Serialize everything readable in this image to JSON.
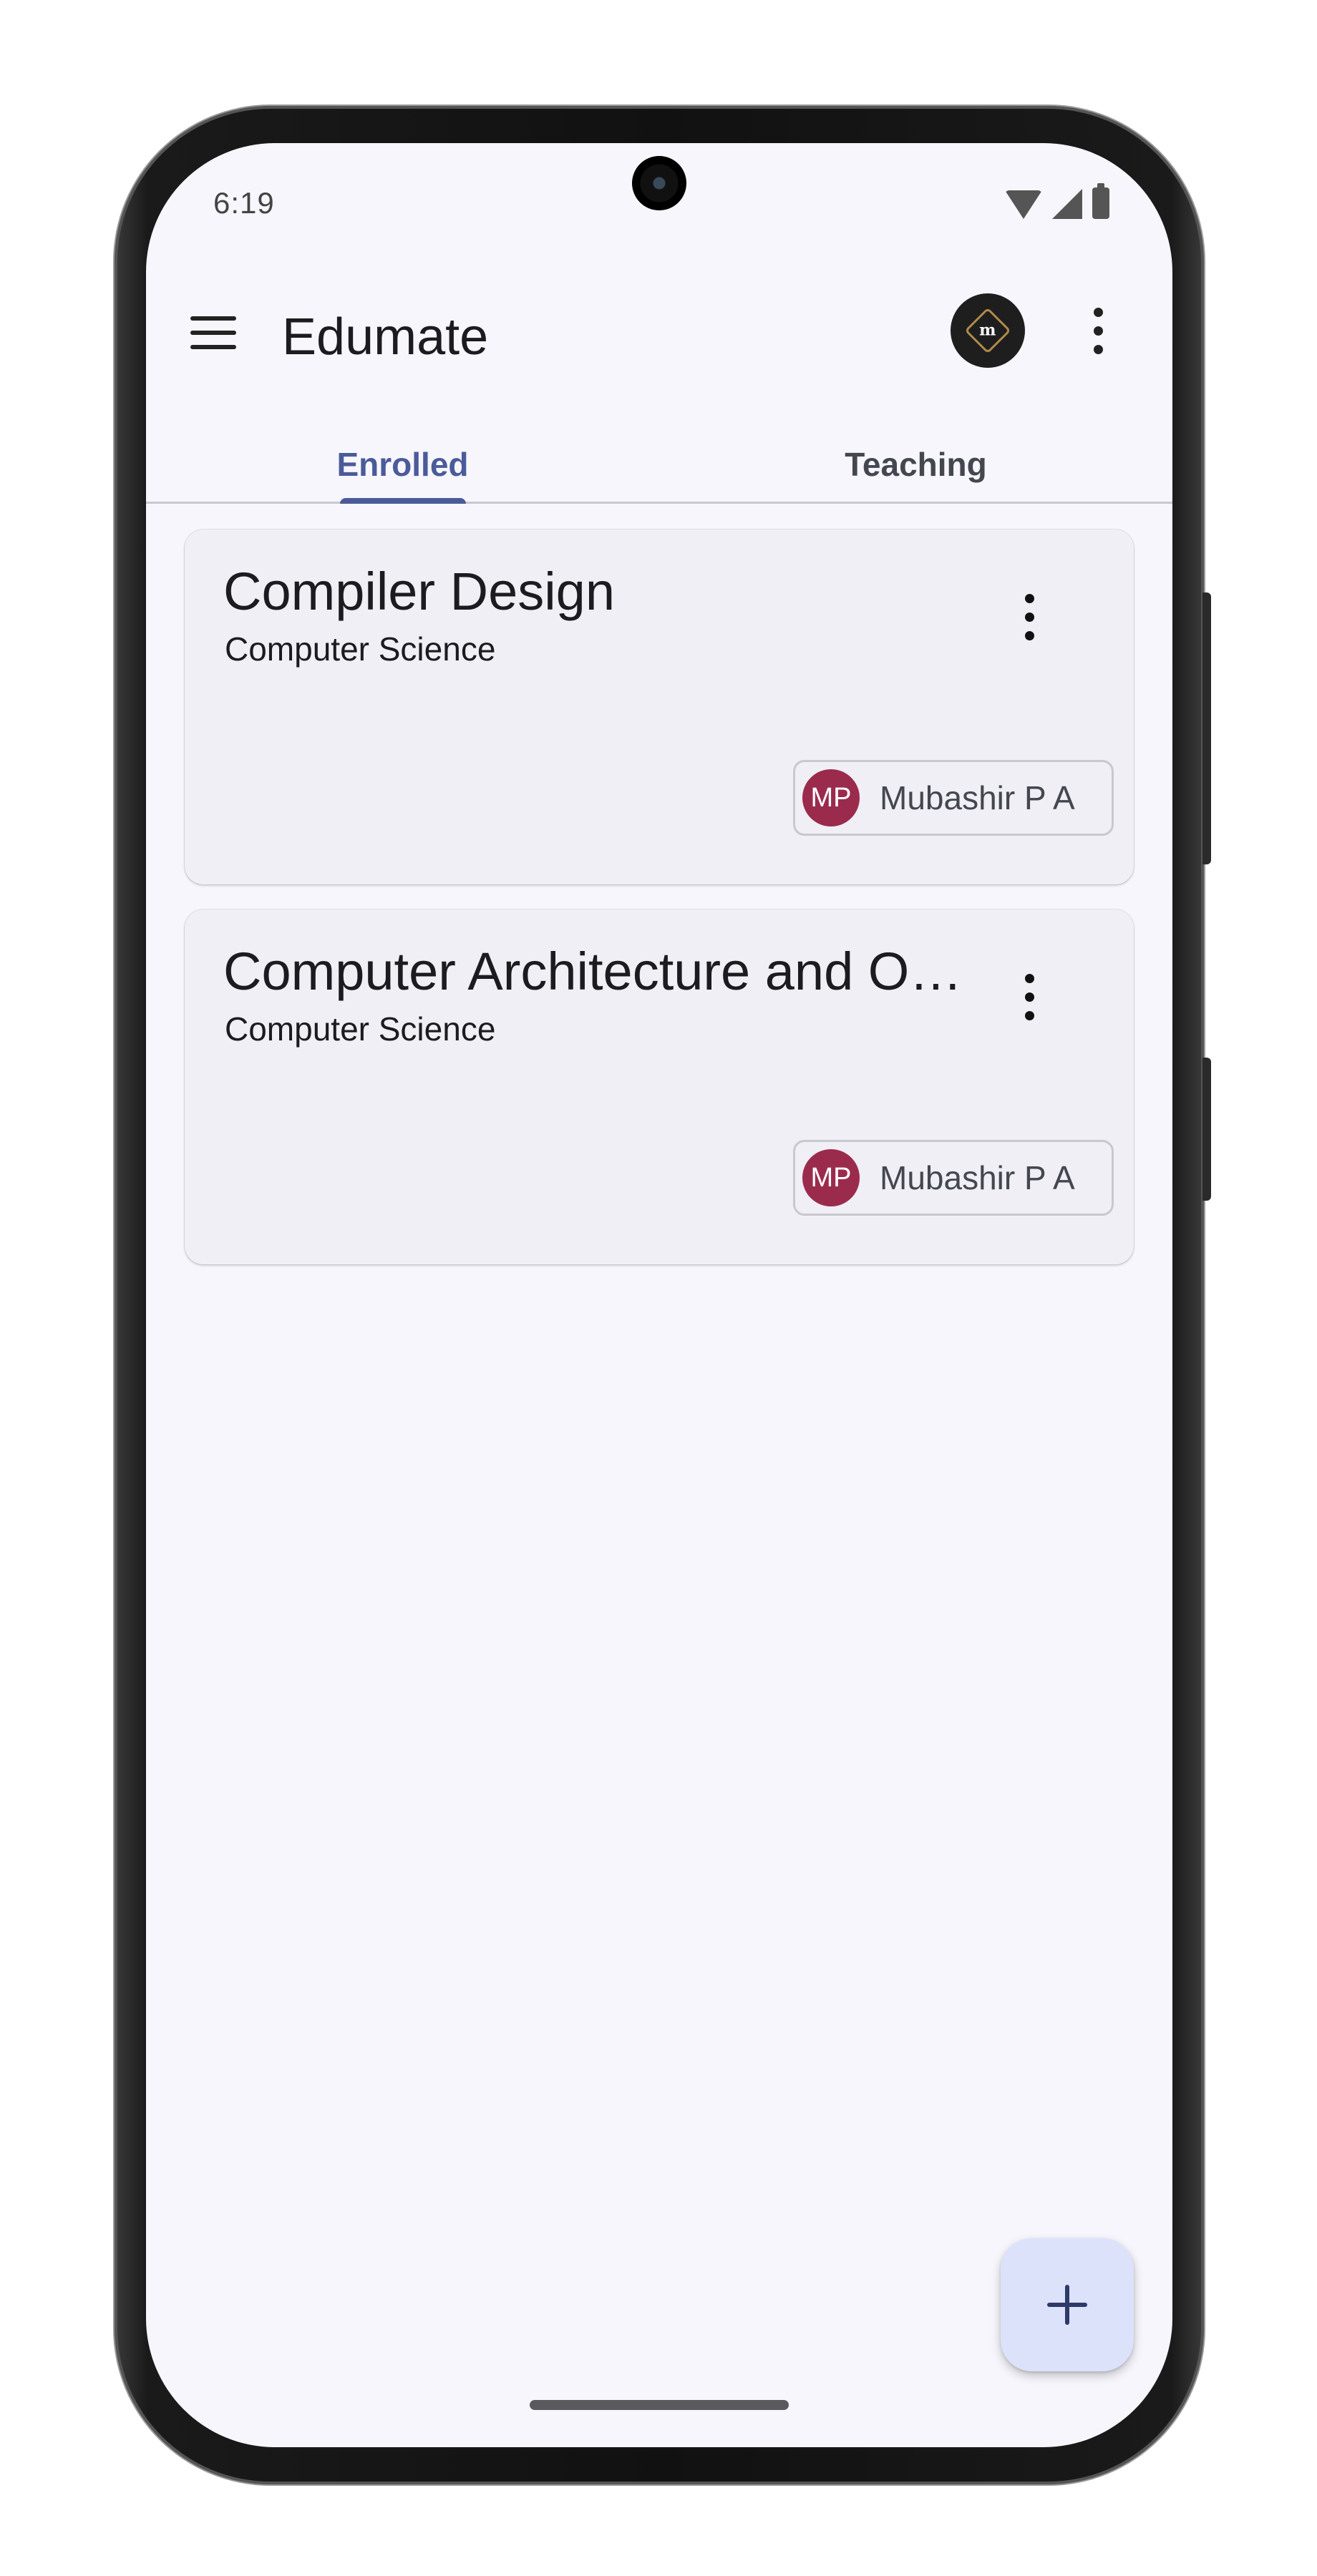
{
  "status_bar": {
    "time": "6:19"
  },
  "app_bar": {
    "title": "Edumate",
    "logo_text": "m"
  },
  "tabs": [
    {
      "label": "Enrolled",
      "selected": true
    },
    {
      "label": "Teaching",
      "selected": false
    }
  ],
  "courses": [
    {
      "title": "Compiler Design",
      "subtitle": "Computer Science",
      "teacher_initials": "MP",
      "teacher_name": "Mubashir P A"
    },
    {
      "title": "Computer Architecture and Or…",
      "subtitle": "Computer Science",
      "teacher_initials": "MP",
      "teacher_name": "Mubashir P A"
    }
  ],
  "fab": {
    "icon": "plus-icon"
  },
  "colors": {
    "accent": "#4a5b9a",
    "background": "#f7f6fc",
    "card": "#f0eff5",
    "avatar": "#9b2b4c",
    "fab": "#dde2fb"
  }
}
